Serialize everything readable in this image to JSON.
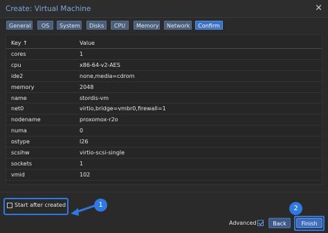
{
  "window": {
    "title": "Create: Virtual Machine",
    "close_glyph": "×"
  },
  "tabs": [
    {
      "label": "General",
      "active": false
    },
    {
      "label": "OS",
      "active": false
    },
    {
      "label": "System",
      "active": false
    },
    {
      "label": "Disks",
      "active": false
    },
    {
      "label": "CPU",
      "active": false
    },
    {
      "label": "Memory",
      "active": false
    },
    {
      "label": "Network",
      "active": false
    },
    {
      "label": "Confirm",
      "active": true
    }
  ],
  "grid": {
    "headers": {
      "key": "Key ↑",
      "value": "Value"
    },
    "rows": [
      {
        "key": "cores",
        "value": "1"
      },
      {
        "key": "cpu",
        "value": "x86-64-v2-AES"
      },
      {
        "key": "ide2",
        "value": "none,media=cdrom"
      },
      {
        "key": "memory",
        "value": "2048"
      },
      {
        "key": "name",
        "value": "stordis-vm"
      },
      {
        "key": "net0",
        "value": "virtio,bridge=vmbr0,firewall=1"
      },
      {
        "key": "nodename",
        "value": "proxomox-r2o"
      },
      {
        "key": "numa",
        "value": "0"
      },
      {
        "key": "ostype",
        "value": "l26"
      },
      {
        "key": "scsihw",
        "value": "virtio-scsi-single"
      },
      {
        "key": "sockets",
        "value": "1"
      },
      {
        "key": "vmid",
        "value": "102"
      }
    ]
  },
  "footer": {
    "start_after_created_label": "Start after created",
    "start_after_created_checked": false,
    "advanced_label": "Advanced",
    "advanced_checked": true,
    "back_label": "Back",
    "finish_label": "Finish"
  },
  "annotations": {
    "badge1": "1",
    "badge2": "2",
    "accent_color": "#2f79e0"
  }
}
